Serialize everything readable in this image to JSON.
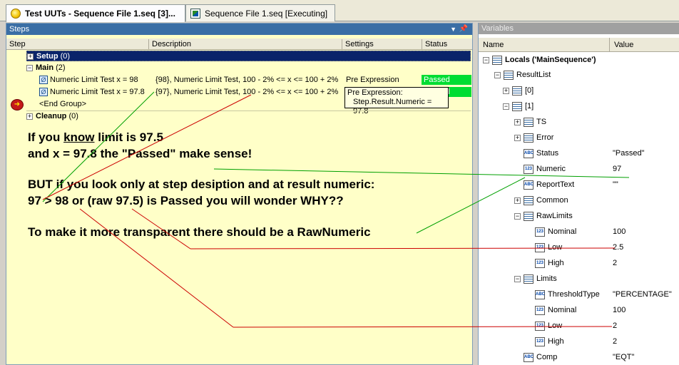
{
  "tabs": [
    {
      "label": "Test UUTs - Sequence File 1.seq [3]..."
    },
    {
      "label": "Sequence File 1.seq [Executing]"
    }
  ],
  "steps_pane": {
    "title": "Steps",
    "columns": [
      "Step",
      "Description",
      "Settings",
      "Status"
    ],
    "groups": {
      "setup": {
        "label": "Setup",
        "count": "(0)"
      },
      "main": {
        "label": "Main",
        "count": "(2)"
      },
      "end_group": "<End Group>",
      "cleanup": {
        "label": "Cleanup",
        "count": "(0)"
      }
    },
    "rows": [
      {
        "step": "Numeric Limit Test x = 98",
        "description": "{98}, Numeric Limit Test,  100 - 2% <= x <= 100 + 2%",
        "settings": "Pre Expression",
        "status": "Passed"
      },
      {
        "step": "Numeric Limit Test x = 97.8",
        "description": "{97}, Numeric Limit Test,  100 - 2% <= x <= 100 + 2%",
        "settings": "Pre Expression:",
        "status": "Passed"
      }
    ],
    "tooltip": {
      "line1": "Pre Expression:",
      "line2": "Step.Result.Numeric = 97.8"
    }
  },
  "notes": {
    "line1_a": "If you ",
    "line1_b": "know",
    "line1_c": " limit is 97.5",
    "line2": "and x = 97.8  the \"Passed\" make sense!",
    "line3": "BUT if you look only at step desiption and at result numeric:",
    "line4": "97 > 98 or (raw 97.5)  is Passed you will wonder WHY??",
    "line5": "To make it more transparent there should be a RawNumeric"
  },
  "variables_pane": {
    "title": "Variables",
    "columns": [
      "Name",
      "Value"
    ],
    "root": "Locals ('MainSequence')",
    "items": [
      {
        "name": "ResultList",
        "value": ""
      },
      {
        "name": "[0]",
        "value": ""
      },
      {
        "name": "[1]",
        "value": ""
      },
      {
        "name": "TS",
        "value": ""
      },
      {
        "name": "Error",
        "value": ""
      },
      {
        "name": "Status",
        "value": "\"Passed\""
      },
      {
        "name": "Numeric",
        "value": "97"
      },
      {
        "name": "ReportText",
        "value": "\"\""
      },
      {
        "name": "Common",
        "value": ""
      },
      {
        "name": "RawLimits",
        "value": ""
      },
      {
        "name": "Nominal",
        "value": "100"
      },
      {
        "name": "Low",
        "value": "2.5"
      },
      {
        "name": "High",
        "value": "2"
      },
      {
        "name": "Limits",
        "value": ""
      },
      {
        "name": "ThresholdType",
        "value": "\"PERCENTAGE\""
      },
      {
        "name": "Nominal",
        "value": "100"
      },
      {
        "name": "Low",
        "value": "2"
      },
      {
        "name": "High",
        "value": "2"
      },
      {
        "name": "Comp",
        "value": "\"EQT\""
      }
    ]
  },
  "colors": {
    "passed": "#00dd33",
    "annotation_red": "#cc0000",
    "annotation_green": "#00a000",
    "steps_bg": "#ffffc8"
  }
}
